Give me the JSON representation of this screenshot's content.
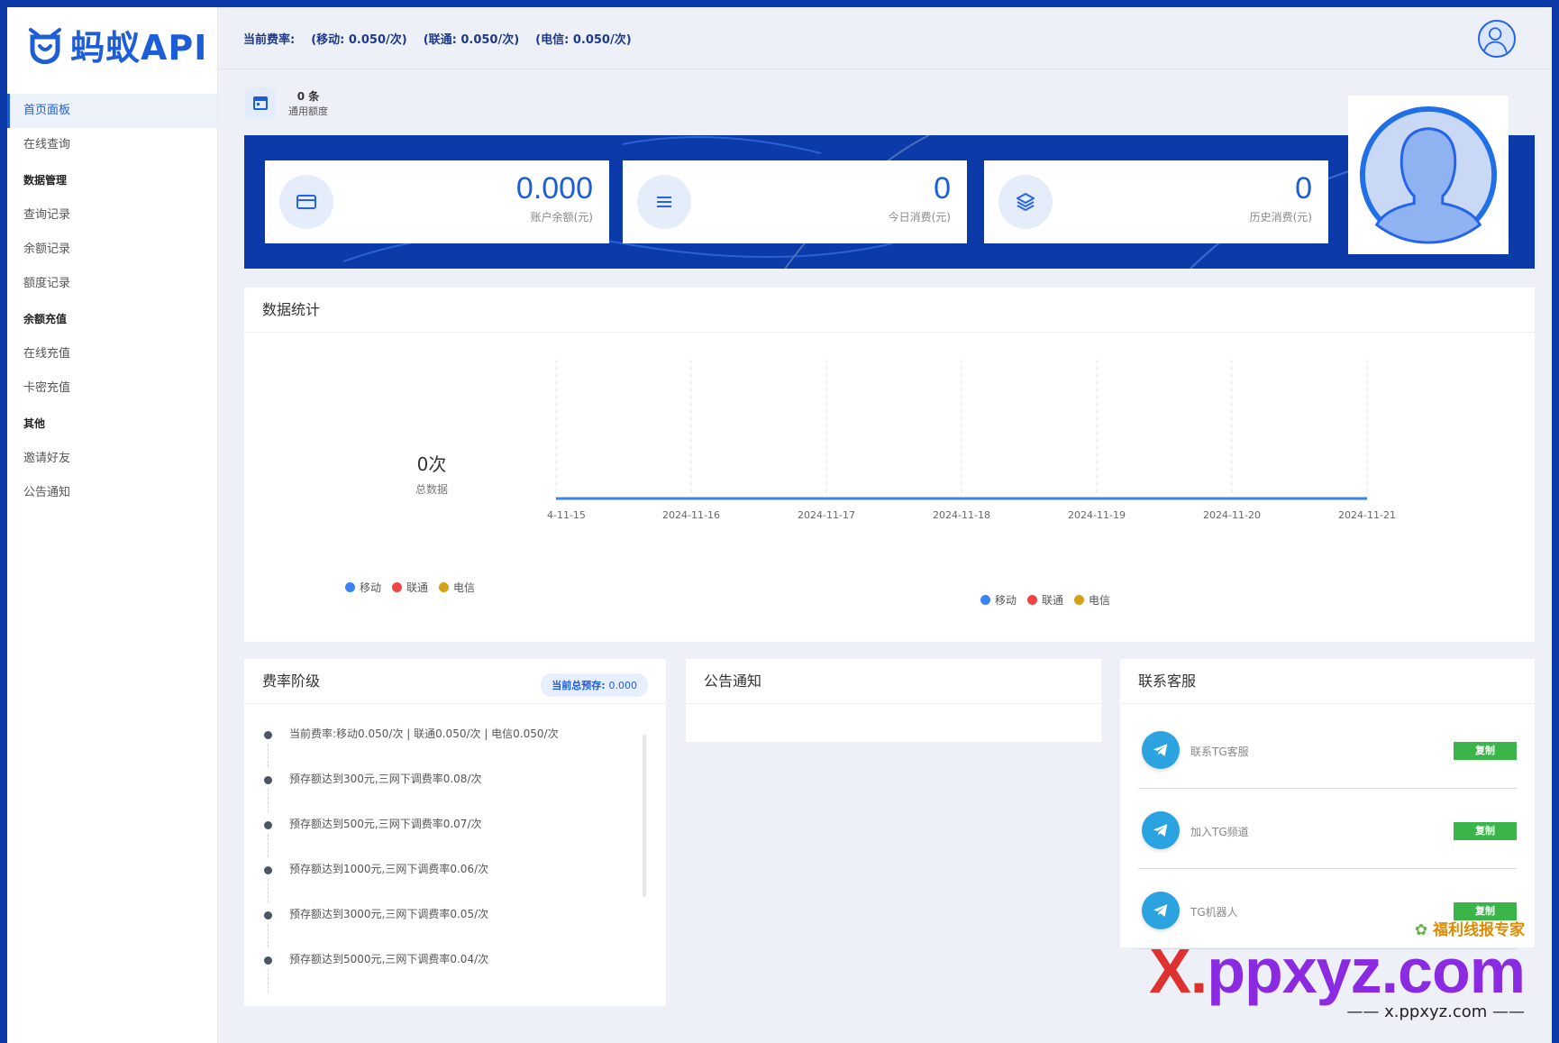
{
  "logo": {
    "text": "蚂蚁API"
  },
  "sidebar": {
    "items": [
      {
        "label": "首页面板",
        "type": "item",
        "active": true
      },
      {
        "label": "在线查询",
        "type": "item"
      },
      {
        "label": "数据管理",
        "type": "group"
      },
      {
        "label": "查询记录",
        "type": "item"
      },
      {
        "label": "余额记录",
        "type": "item"
      },
      {
        "label": "额度记录",
        "type": "item"
      },
      {
        "label": "余额充值",
        "type": "group"
      },
      {
        "label": "在线充值",
        "type": "item"
      },
      {
        "label": "卡密充值",
        "type": "item"
      },
      {
        "label": "其他",
        "type": "group"
      },
      {
        "label": "邀请好友",
        "type": "item"
      },
      {
        "label": "公告通知",
        "type": "item"
      }
    ]
  },
  "header": {
    "rate_label": "当前费率:",
    "rates": [
      "(移动: 0.050/次)",
      "(联通: 0.050/次)",
      "(电信: 0.050/次)"
    ]
  },
  "quota": {
    "count": "0 条",
    "label": "通用额度"
  },
  "stats": [
    {
      "value": "0.000",
      "label": "账户余额(元)",
      "icon": "card-icon"
    },
    {
      "value": "0",
      "label": "今日消费(元)",
      "icon": "list-icon"
    },
    {
      "value": "0",
      "label": "历史消费(元)",
      "icon": "layers-icon"
    }
  ],
  "data_panel": {
    "title": "数据统计",
    "total_value": "0次",
    "total_label": "总数据"
  },
  "chart_data": {
    "type": "line",
    "x": [
      "4-11-15",
      "2024-11-16",
      "2024-11-17",
      "2024-11-18",
      "2024-11-19",
      "2024-11-20",
      "2024-11-21"
    ],
    "series": [
      {
        "name": "移动",
        "color": "#3b82f6",
        "values": [
          0,
          0,
          0,
          0,
          0,
          0,
          0
        ]
      },
      {
        "name": "联通",
        "color": "#ef4444",
        "values": [
          0,
          0,
          0,
          0,
          0,
          0,
          0
        ]
      },
      {
        "name": "电信",
        "color": "#d4a017",
        "values": [
          0,
          0,
          0,
          0,
          0,
          0,
          0
        ]
      }
    ],
    "legend_position": "bottom",
    "grid": "vertical-dashed"
  },
  "pie_legend": [
    {
      "name": "移动",
      "color": "#3b82f6"
    },
    {
      "name": "联通",
      "color": "#ef4444"
    },
    {
      "name": "电信",
      "color": "#d4a017"
    }
  ],
  "rate_panel": {
    "title": "费率阶级",
    "badge_label": "当前总预存:",
    "badge_value": "0.000",
    "items": [
      "当前费率:移动0.050/次 | 联通0.050/次 | 电信0.050/次",
      "预存额达到300元,三网下调费率0.08/次",
      "预存额达到500元,三网下调费率0.07/次",
      "预存额达到1000元,三网下调费率0.06/次",
      "预存额达到3000元,三网下调费率0.05/次",
      "预存额达到5000元,三网下调费率0.04/次"
    ]
  },
  "notice_panel": {
    "title": "公告通知"
  },
  "contact_panel": {
    "title": "联系客服",
    "items": [
      {
        "label": "联系TG客服",
        "button": "复制"
      },
      {
        "label": "加入TG频道",
        "button": "复制"
      },
      {
        "label": "TG机器人",
        "button": "复制"
      }
    ]
  },
  "watermark": {
    "tagline": "福利线报专家",
    "brand_x": "X.",
    "brand_rest": "ppxyz.com",
    "url": "—— x.ppxyz.com ——"
  },
  "colors": {
    "primary": "#1d5ed8",
    "banner": "#0c3aa8",
    "copy_button": "#3bb54a"
  }
}
